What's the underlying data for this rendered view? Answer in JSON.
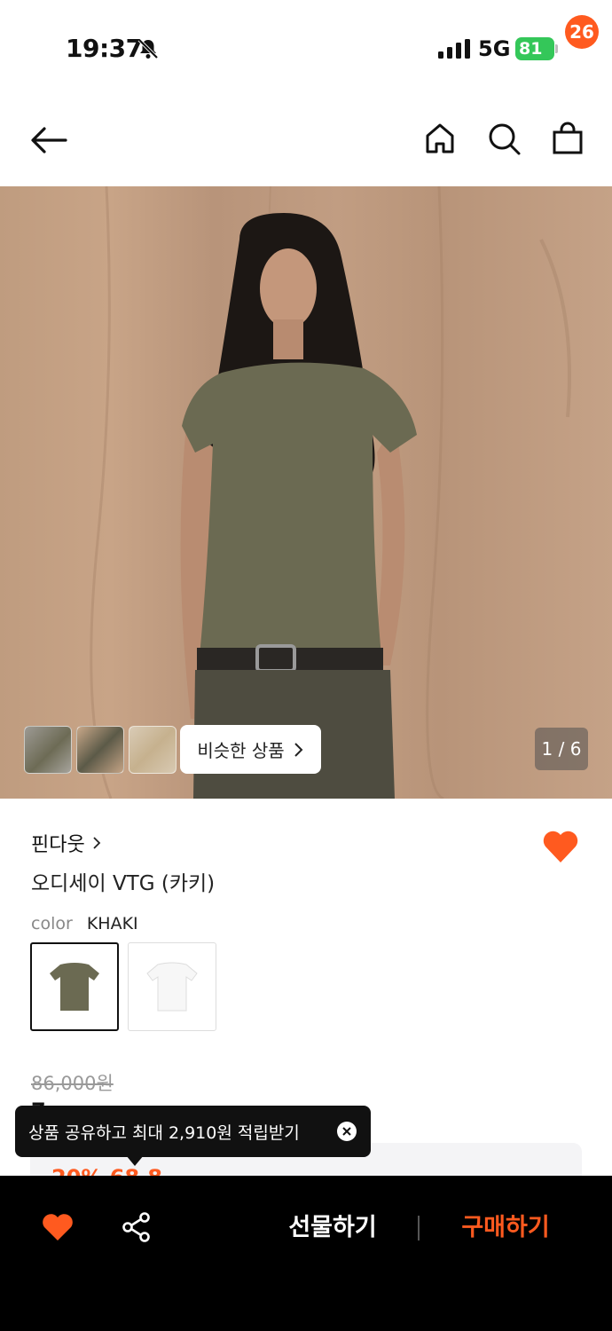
{
  "status_bar": {
    "time": "19:37",
    "network": "5G",
    "battery": "81"
  },
  "header": {
    "cart_count": "26"
  },
  "gallery": {
    "similar_label": "비슷한 상품",
    "page_indicator": "1 / 6"
  },
  "product": {
    "brand": "핀다웃",
    "title": "오디세이 VTG (카키)",
    "color_label": "color",
    "color_value": "KHAKI",
    "original_price": "86,000원",
    "sale_price_partial": "7",
    "discount_partial": "20% 68,8"
  },
  "tooltip": {
    "text": "상품 공유하고 최대 2,910원 적립받기"
  },
  "bottom_bar": {
    "gift_label": "선물하기",
    "buy_label": "구매하기"
  },
  "colors": {
    "accent": "#ff5a1f",
    "battery": "#34c759",
    "khaki": "#6b6a52"
  }
}
